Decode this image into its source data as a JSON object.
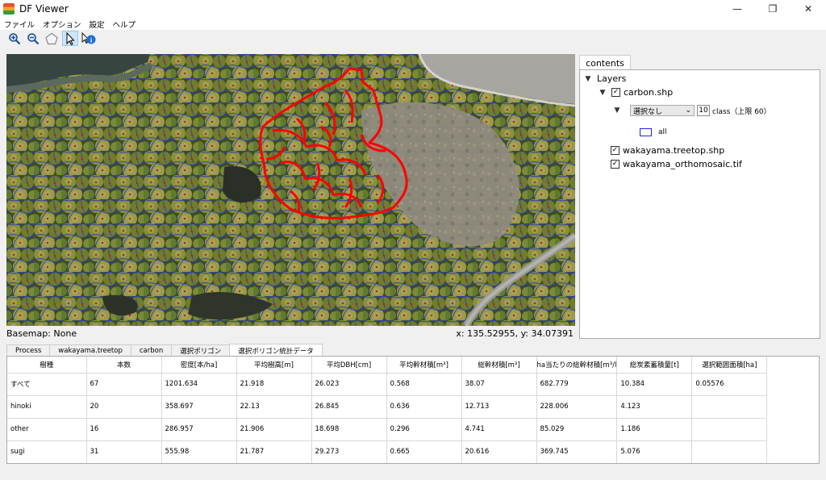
{
  "window": {
    "title": "DF Viewer",
    "minimize": "—",
    "restore": "❐",
    "close": "✕"
  },
  "menu": [
    "ファイル",
    "オプション",
    "設定",
    "ヘルプ"
  ],
  "toolbar": {
    "tools": [
      {
        "name": "zoom-in-icon",
        "glyph": "⊕"
      },
      {
        "name": "zoom-out-icon",
        "glyph": "⊖"
      },
      {
        "name": "polygon-icon",
        "glyph": "⬠"
      },
      {
        "name": "pointer-icon",
        "glyph": "➤"
      },
      {
        "name": "info-icon",
        "glyph": "ℹ"
      }
    ]
  },
  "status": {
    "basemap": "Basemap: None",
    "coords": "x: 135.52955, y: 34.07391"
  },
  "panel": {
    "tab": "contents",
    "root": "Layers",
    "layer1": "carbon.shp",
    "select_value": "選択なし",
    "class_count": "10",
    "class_label": "class（上限 60）",
    "legend_label": "all",
    "layer2": "wakayama.treetop.shp",
    "layer3": "wakayama_orthomosaic.tif",
    "legend_color": "#2222ee"
  },
  "bottom_tabs": [
    "Process",
    "wakayama.treetop",
    "carbon",
    "選択ポリゴン",
    "選択ポリゴン統計データ"
  ],
  "table": {
    "headers": [
      "樹種",
      "本数",
      "密度[本/ha]",
      "平均樹高[m]",
      "平均DBH[cm]",
      "平均幹材積[m³]",
      "総幹材積[m³]",
      "ha当たりの総幹材積[m³/l",
      "総炭素蓄積量[t]",
      "選択範囲面積[ha]"
    ],
    "rows": [
      [
        "すべて",
        "67",
        "1201.634",
        "21.918",
        "26.023",
        "0.568",
        "38.07",
        "682.779",
        "10.384",
        "0.05576"
      ],
      [
        "hinoki",
        "20",
        "358.697",
        "22.13",
        "26.845",
        "0.636",
        "12.713",
        "228.006",
        "4.123",
        ""
      ],
      [
        "other",
        "16",
        "286.957",
        "21.906",
        "18.698",
        "0.296",
        "4.741",
        "85.029",
        "1.186",
        ""
      ],
      [
        "sugi",
        "31",
        "555.98",
        "21.787",
        "29.273",
        "0.665",
        "20.616",
        "369.745",
        "5.076",
        ""
      ]
    ]
  }
}
